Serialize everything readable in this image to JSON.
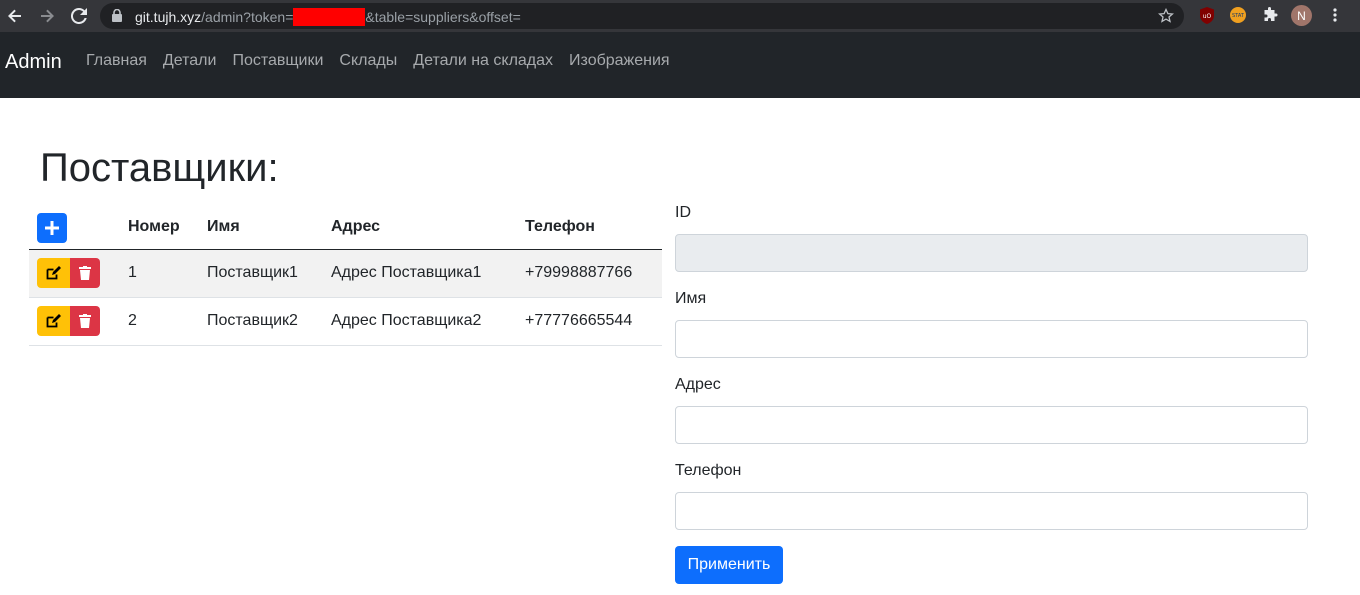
{
  "browser": {
    "url_host": "git.tujh.xyz",
    "url_path": "/admin?token=",
    "url_query": "&table=suppliers&offset=",
    "profile_initial": "N",
    "extension_badge": "JSTAT"
  },
  "navbar": {
    "brand": "Admin",
    "links": [
      {
        "label": "Главная"
      },
      {
        "label": "Детали"
      },
      {
        "label": "Поставщики"
      },
      {
        "label": "Склады"
      },
      {
        "label": "Детали на складах"
      },
      {
        "label": "Изображения"
      }
    ]
  },
  "page": {
    "title": "Поставщики:"
  },
  "table": {
    "headers": [
      "Номер",
      "Имя",
      "Адрес",
      "Телефон"
    ],
    "rows": [
      {
        "id": "1",
        "name": "Поставщик1",
        "address": "Адрес Поставщика1",
        "phone": "+79998887766"
      },
      {
        "id": "2",
        "name": "Поставщик2",
        "address": "Адрес Поставщика2",
        "phone": "+77776665544"
      }
    ]
  },
  "form": {
    "id_label": "ID",
    "id_value": "",
    "name_label": "Имя",
    "name_value": "",
    "address_label": "Адрес",
    "address_value": "",
    "phone_label": "Телефон",
    "phone_value": "",
    "submit_label": "Применить"
  },
  "colors": {
    "primary": "#0d6efd",
    "warning": "#ffc107",
    "danger": "#dc3545",
    "navbar": "#212529"
  }
}
